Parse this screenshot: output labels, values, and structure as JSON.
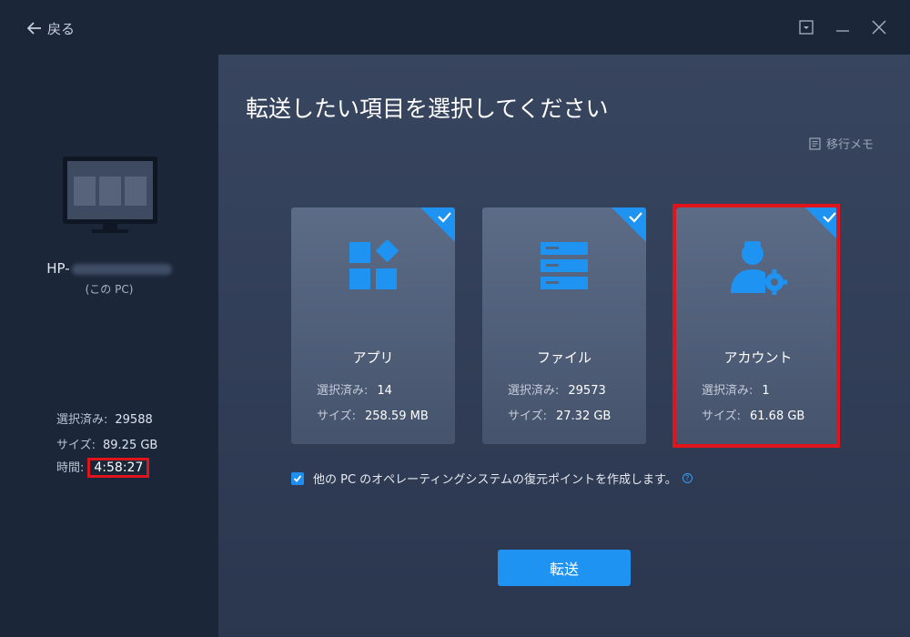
{
  "titlebar": {
    "back_label": "戻る"
  },
  "sidebar": {
    "pc_name": "HP-",
    "pc_sub": "(この PC)",
    "stats": {
      "selected_label": "選択済み:",
      "selected_value": "29588",
      "size_label": "サイズ:",
      "size_value": "89.25 GB",
      "time_label": "時間:",
      "time_value": "4:58:27"
    }
  },
  "main": {
    "heading": "転送したい項目を選択してください",
    "memo_label": "移行メモ",
    "cards": [
      {
        "name": "アプリ",
        "selected_label": "選択済み:",
        "selected_value": "14",
        "size_label": "サイズ:",
        "size_value": "258.59 MB",
        "icon": "apps-icon",
        "checked": true
      },
      {
        "name": "ファイル",
        "selected_label": "選択済み:",
        "selected_value": "29573",
        "size_label": "サイズ:",
        "size_value": "27.32 GB",
        "icon": "files-icon",
        "checked": true
      },
      {
        "name": "アカウント",
        "selected_label": "選択済み:",
        "selected_value": "1",
        "size_label": "サイズ:",
        "size_value": "61.68 GB",
        "icon": "account-settings-icon",
        "checked": true
      }
    ],
    "restore_point_label": "他の PC のオペレーティングシステムの復元ポイントを作成します。",
    "restore_point_checked": true,
    "help_glyph": "?",
    "transfer_label": "転送"
  },
  "colors": {
    "accent": "#1f93f1",
    "highlight": "#e0141b",
    "sidebar_bg": "#1c2639",
    "card_bg": "#5d6c86"
  }
}
